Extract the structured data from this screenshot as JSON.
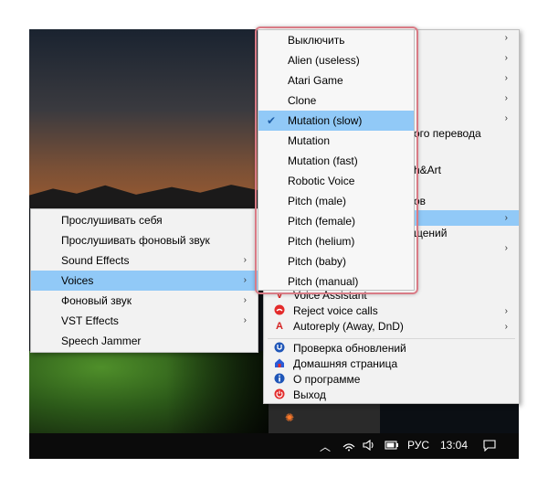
{
  "app_menu": {
    "items": [
      {
        "label": "",
        "arrow": "›",
        "icon": ""
      },
      {
        "label": "",
        "arrow": "›",
        "icon": ""
      },
      {
        "label": "",
        "arrow": "›",
        "icon": ""
      },
      {
        "label": "",
        "arrow": "›",
        "icon": ""
      },
      {
        "label": "",
        "arrow": "›",
        "icon": ""
      },
      {
        "label": "ого перевода",
        "arrow": "",
        "icon": ""
      },
      {
        "label": "h&Art",
        "arrow": "",
        "icon": ""
      },
      {
        "label": "ов",
        "arrow": "",
        "icon": ""
      },
      {
        "label": "",
        "arrow": "›",
        "icon": ""
      },
      {
        "label": "щений",
        "arrow": "",
        "icon": ""
      },
      {
        "label": "",
        "arrow": "›",
        "icon": ""
      },
      {
        "label": "",
        "arrow": "",
        "icon": ""
      },
      {
        "label": "Voice Assistant",
        "arrow": "",
        "icon": "v"
      },
      {
        "label": "Reject voice calls",
        "arrow": "›",
        "icon": "phone-reject-icon"
      },
      {
        "label": "Autoreply (Away, DnD)",
        "arrow": "›",
        "icon": "A"
      },
      {
        "label": "Проверка обновлений",
        "arrow": "",
        "icon": "update-icon"
      },
      {
        "label": "Домашняя страница",
        "arrow": "",
        "icon": "home-icon"
      },
      {
        "label": "О программе",
        "arrow": "",
        "icon": "info-icon"
      },
      {
        "label": "Выход",
        "arrow": "",
        "icon": "power-icon"
      }
    ]
  },
  "left_menu": {
    "items": [
      {
        "label": "Прослушивать себя",
        "arrow": ""
      },
      {
        "label": "Прослушивать фоновый звук",
        "arrow": ""
      },
      {
        "label": "Sound Effects",
        "arrow": "›"
      },
      {
        "label": "Voices",
        "arrow": "›"
      },
      {
        "label": "Фоновый звук",
        "arrow": "›"
      },
      {
        "label": "VST Effects",
        "arrow": "›"
      },
      {
        "label": "Speech Jammer",
        "arrow": ""
      }
    ]
  },
  "voices_menu": {
    "selected": "Mutation (slow)",
    "items": [
      "Выключить",
      "Alien (useless)",
      "Atari Game",
      "Clone",
      "Mutation (slow)",
      "Mutation",
      "Mutation (fast)",
      "Robotic Voice",
      "Pitch (male)",
      "Pitch (female)",
      "Pitch (helium)",
      "Pitch (baby)",
      "Pitch (manual)"
    ]
  },
  "taskbar": {
    "language": "РУС",
    "clock": "13:04",
    "icons": [
      "chevron-up-icon",
      "wifi-icon",
      "volume-icon",
      "battery-icon",
      "notification-icon"
    ]
  },
  "colors": {
    "highlight": "#91c9f7",
    "outline": "#d97b86",
    "check": "#1f5fa8"
  }
}
